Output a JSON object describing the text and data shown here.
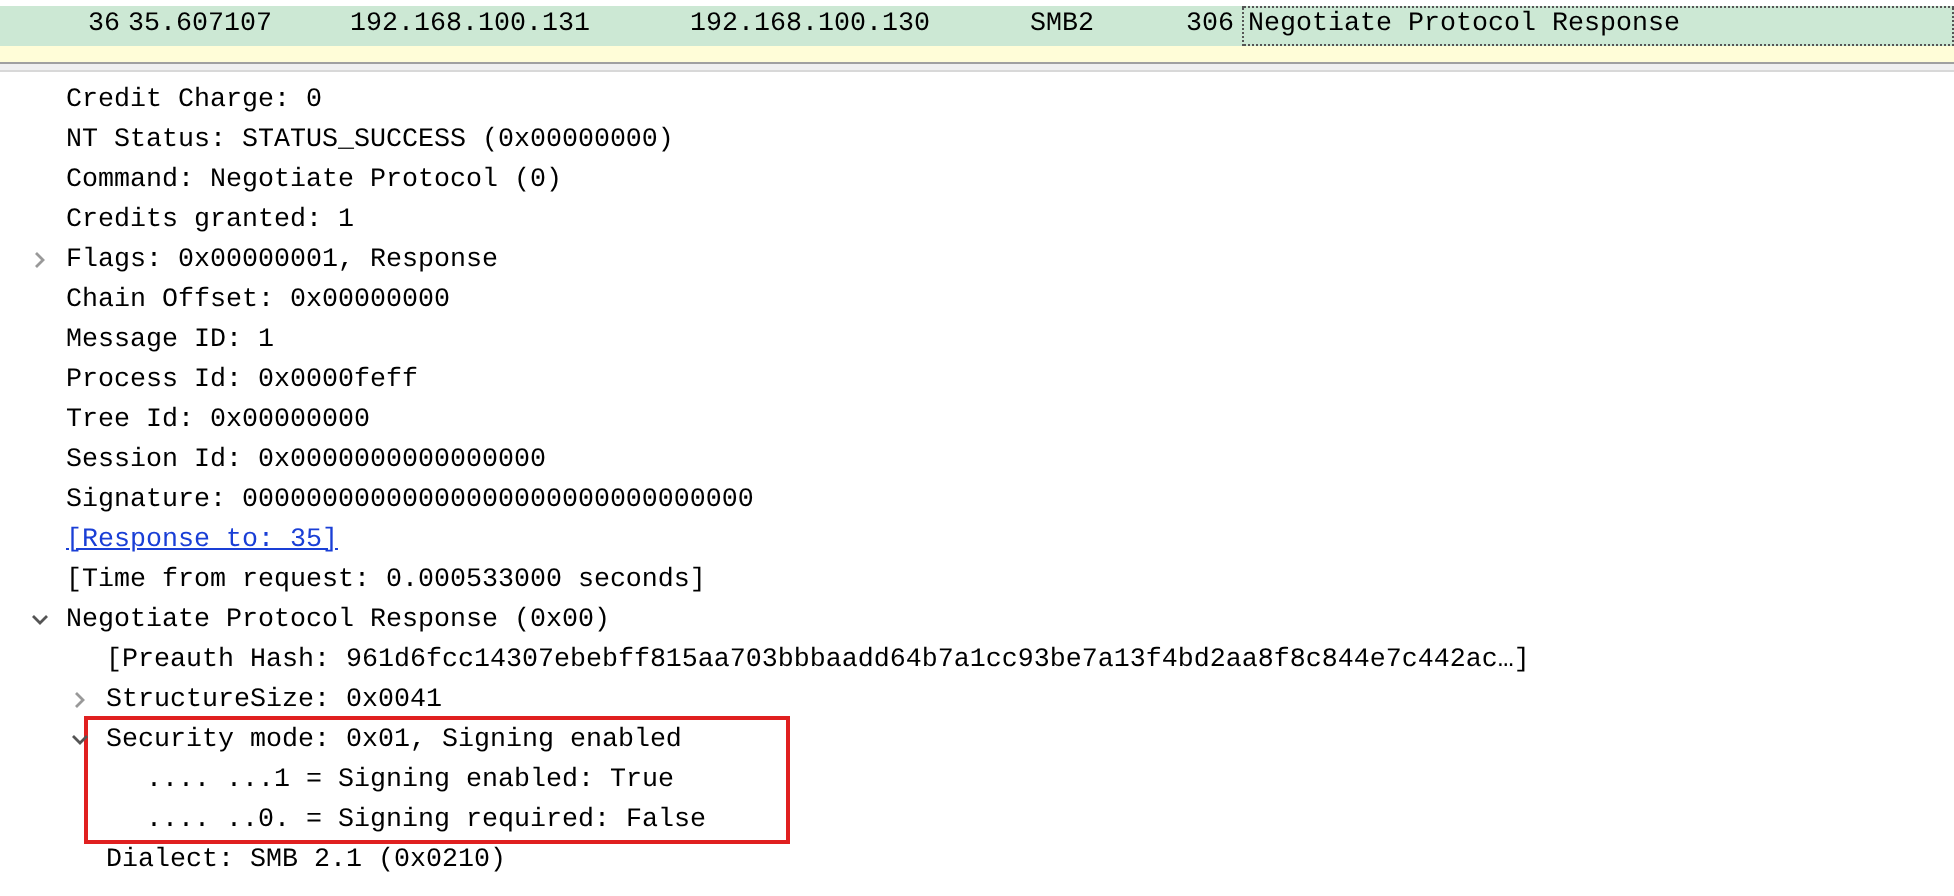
{
  "packet_list": {
    "rows": [
      {
        "no": "36",
        "time": "35.607107",
        "source": "192.168.100.131",
        "destination": "192.168.100.130",
        "protocol": "SMB2",
        "length": "306",
        "info": "Negotiate Protocol Response",
        "selected": true
      },
      {
        "selected": false
      }
    ]
  },
  "details": {
    "tree": [
      {
        "children": [
          {
            "label": "Credit Charge: 0"
          },
          {
            "label": "NT Status: STATUS_SUCCESS (0x00000000)"
          },
          {
            "label": "Command: Negotiate Protocol (0)"
          },
          {
            "label": "Credits granted: 1"
          },
          {
            "label": "Flags: 0x00000001, Response",
            "expanded": false
          },
          {
            "label": "Chain Offset: 0x00000000"
          },
          {
            "label": "Message ID: 1"
          },
          {
            "label": "Process Id: 0x0000feff"
          },
          {
            "label": "Tree Id: 0x00000000"
          },
          {
            "label": "Session Id: 0x0000000000000000"
          },
          {
            "label": "Signature: 00000000000000000000000000000000"
          },
          {
            "label": "[Response to: 35]",
            "kind": "link"
          },
          {
            "label": "[Time from request: 0.000533000 seconds]"
          }
        ]
      },
      {
        "label": "Negotiate Protocol Response (0x00)",
        "expanded": true,
        "children": [
          {
            "label": "[Preauth Hash: 961d6fcc14307ebebff815aa703bbbaadd64b7a1cc93be7a13f4bd2aa8f8c844e7c442ac…]"
          },
          {
            "label": "StructureSize: 0x0041",
            "expanded": false
          },
          {
            "label": "Security mode: 0x01, Signing enabled",
            "expanded": true,
            "highlighted": true,
            "children": [
              {
                "label": ".... ...1 = Signing enabled: True"
              },
              {
                "label": ".... ..0. = Signing required: False"
              }
            ]
          },
          {
            "label": "Dialect: SMB 2.1 (0x0210)"
          }
        ]
      }
    ]
  }
}
